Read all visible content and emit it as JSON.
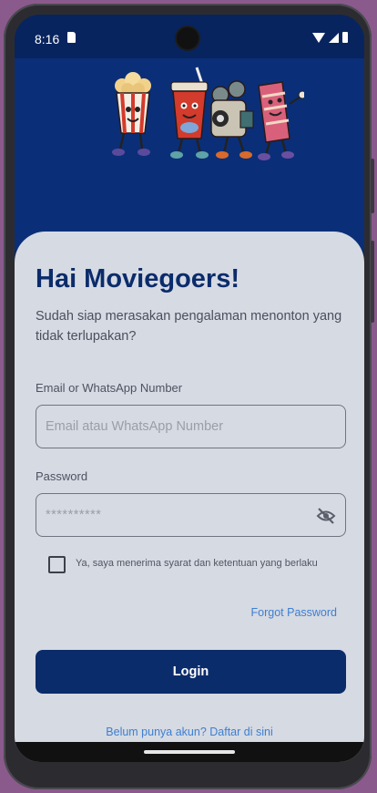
{
  "status_bar": {
    "time": "8:16"
  },
  "card": {
    "title": "Hai Moviegoers!",
    "subtitle": "Sudah siap merasakan pengalaman menonton yang tidak terlupakan?"
  },
  "form": {
    "email_label": "Email or WhatsApp Number",
    "email_placeholder": "Email atau WhatsApp Number",
    "password_label": "Password",
    "password_placeholder": "**********",
    "terms_label": "Ya, saya menerima syarat dan ketentuan yang berlaku",
    "terms_checked": false,
    "forgot_password": "Forgot Password",
    "login_label": "Login",
    "signup_link": "Belum punya akun? Daftar di sini"
  },
  "colors": {
    "brand_navy": "#0b2c6b",
    "link_blue": "#3d7fd1",
    "card_bg": "#d6dae3"
  },
  "icons": [
    "sim-card-icon",
    "wifi-icon",
    "signal-icon",
    "battery-icon",
    "eye-off-icon",
    "movie-mascots-illustration"
  ]
}
